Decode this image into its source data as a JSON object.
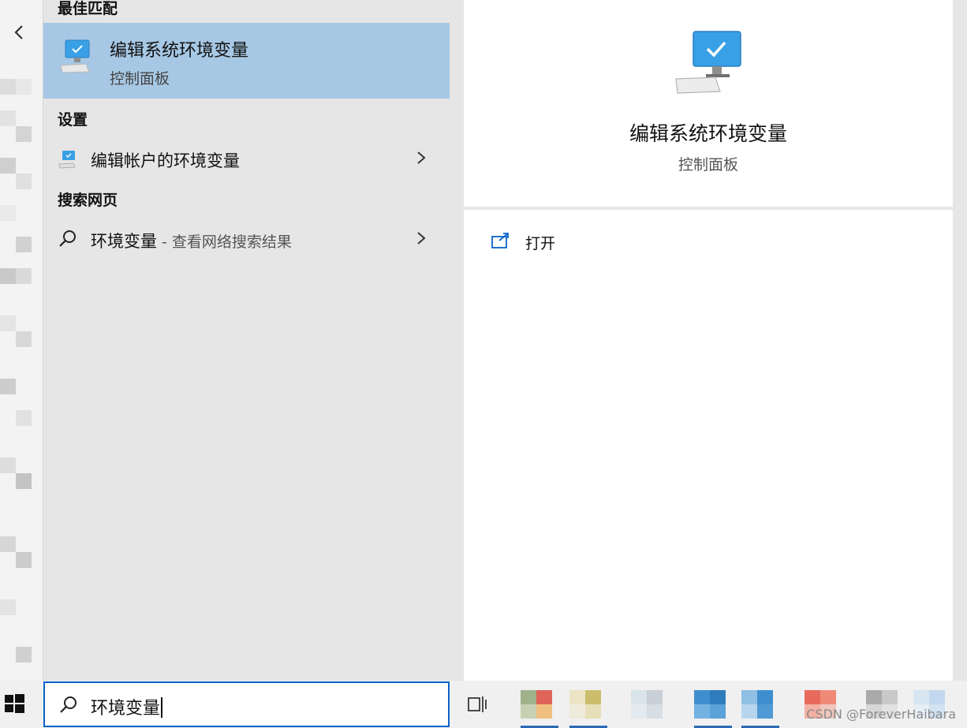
{
  "search": {
    "query": "环境变量"
  },
  "results": {
    "best_match_heading": "最佳匹配",
    "best_match": {
      "title": "编辑系统环境变量",
      "subtitle": "控制面板"
    },
    "settings_heading": "设置",
    "settings_item": {
      "label": "编辑帐户的环境变量"
    },
    "web_heading": "搜索网页",
    "web_item": {
      "label": "环境变量",
      "suffix": " - 查看网络搜索结果"
    }
  },
  "preview": {
    "title": "编辑系统环境变量",
    "subtitle": "控制面板",
    "open_label": "打开"
  },
  "watermark": "CSDN @ForeverHaibara",
  "colors": {
    "selected_bg": "#a7c8e4",
    "accent": "#0a63c9",
    "panel_bg": "#e6e6e6"
  },
  "icons": [
    "back-chevron-icon",
    "monitor-check-icon",
    "magnifier-icon",
    "chevron-right-icon",
    "open-external-icon",
    "windows-logo-icon",
    "task-view-icon"
  ]
}
